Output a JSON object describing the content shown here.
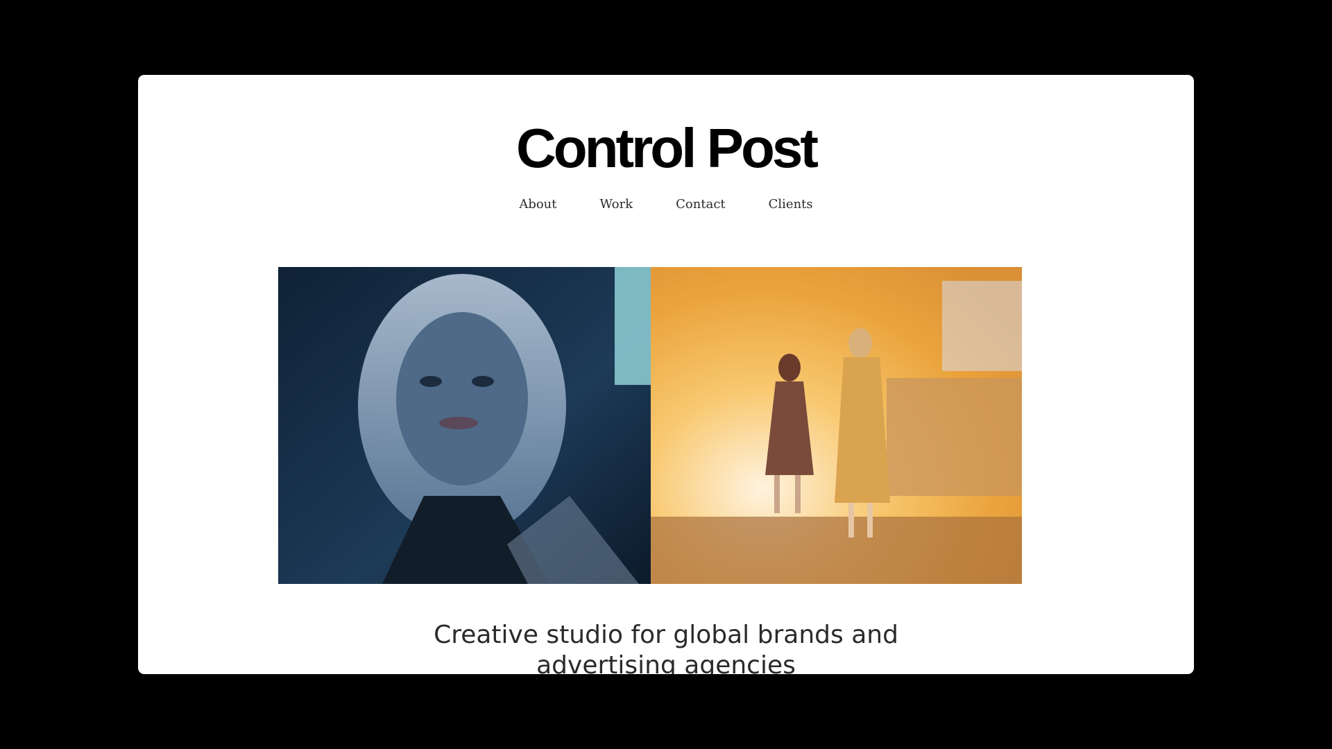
{
  "site": {
    "logo": "Control Post",
    "nav": [
      "About",
      "Work",
      "Contact",
      "Clients"
    ],
    "tagline_line1": "Creative studio for global brands and",
    "tagline_line2": "advertising agencies"
  },
  "colors": {
    "background": "#000000",
    "page": "#ffffff",
    "text": "#2a2a2a",
    "left_image_tone": "#1b3550",
    "right_image_tone": "#f7c46a"
  }
}
